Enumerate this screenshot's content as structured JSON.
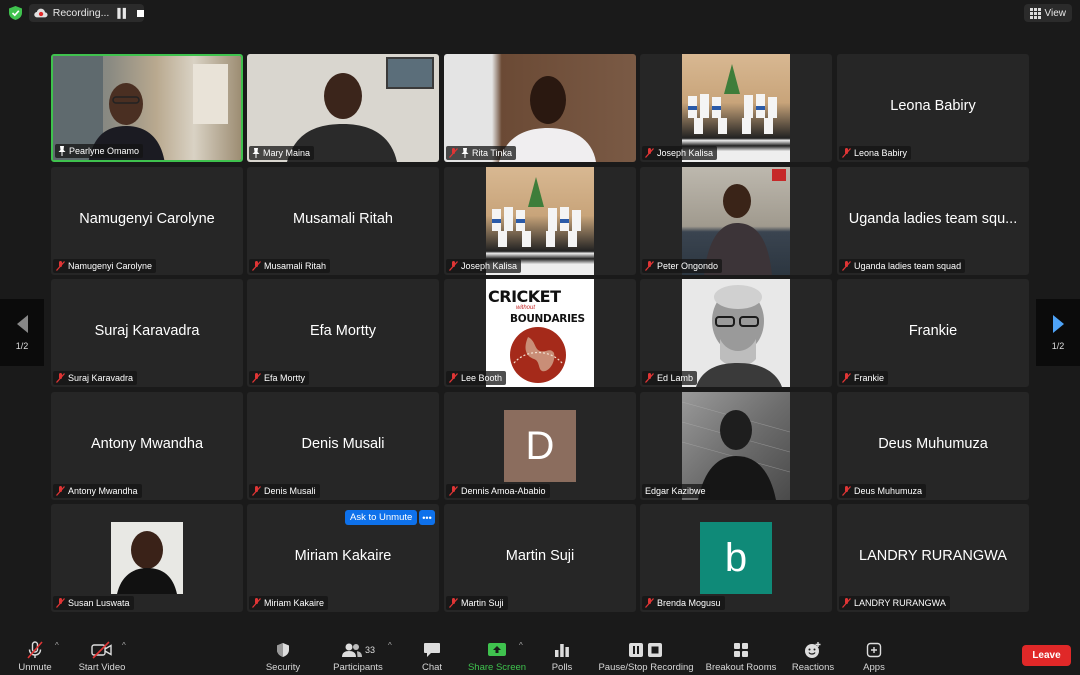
{
  "topbar": {
    "recording_label": "Recording...",
    "view_label": "View"
  },
  "pagination": {
    "left_page": "1/2",
    "right_page": "1/2"
  },
  "participants": {
    "pearlyne": "Pearlyne Omamo",
    "mary": "Mary Maina",
    "rita": "Rita Tinka",
    "joseph1": "Joseph Kalisa",
    "leona": "Leona Babiry",
    "namugenyi": "Namugenyi Carolyne",
    "musamali": "Musamali Ritah",
    "joseph2": "Joseph Kalisa",
    "peter": "Peter Ongondo",
    "uganda_big": "Uganda ladies team squ...",
    "uganda": "Uganda ladies team squad",
    "suraj": "Suraj Karavadra",
    "efa": "Efa Mortty",
    "lee": "Lee Booth",
    "ed": "Ed Lamb",
    "frankie": "Frankie",
    "antony": "Antony Mwandha",
    "denis": "Denis Musali",
    "dennis": "Dennis Amoa-Ababio",
    "edgar": "Edgar Kazibwe",
    "deus": "Deus Muhumuza",
    "susan": "Susan Luswata",
    "miriam": "Miriam Kakaire",
    "martin": "Martin Suji",
    "brenda": "Brenda Mogusu",
    "landry": "LANDRY RURANGWA"
  },
  "avatars": {
    "dennis_initial": "D",
    "dennis_color": "#8b6d5e",
    "brenda_initial": "b",
    "brenda_color": "#0f8a78"
  },
  "cwb_logo": {
    "line1": "CRICKET",
    "line2": "without",
    "line3": "BOUNDARIES"
  },
  "ask_unmute": {
    "label": "Ask to Unmute",
    "more": "•••"
  },
  "toolbar": {
    "unmute": "Unmute",
    "start_video": "Start Video",
    "security": "Security",
    "participants": "Participants",
    "participants_count": "33",
    "chat": "Chat",
    "share_screen": "Share Screen",
    "polls": "Polls",
    "pause_stop_recording": "Pause/Stop Recording",
    "breakout_rooms": "Breakout Rooms",
    "reactions": "Reactions",
    "apps": "Apps",
    "leave": "Leave"
  },
  "colors": {
    "active_speaker_border": "#3fc24e",
    "leave_button": "#e02828",
    "share_screen": "#3fc24e",
    "accent_blue": "#0e71eb"
  }
}
